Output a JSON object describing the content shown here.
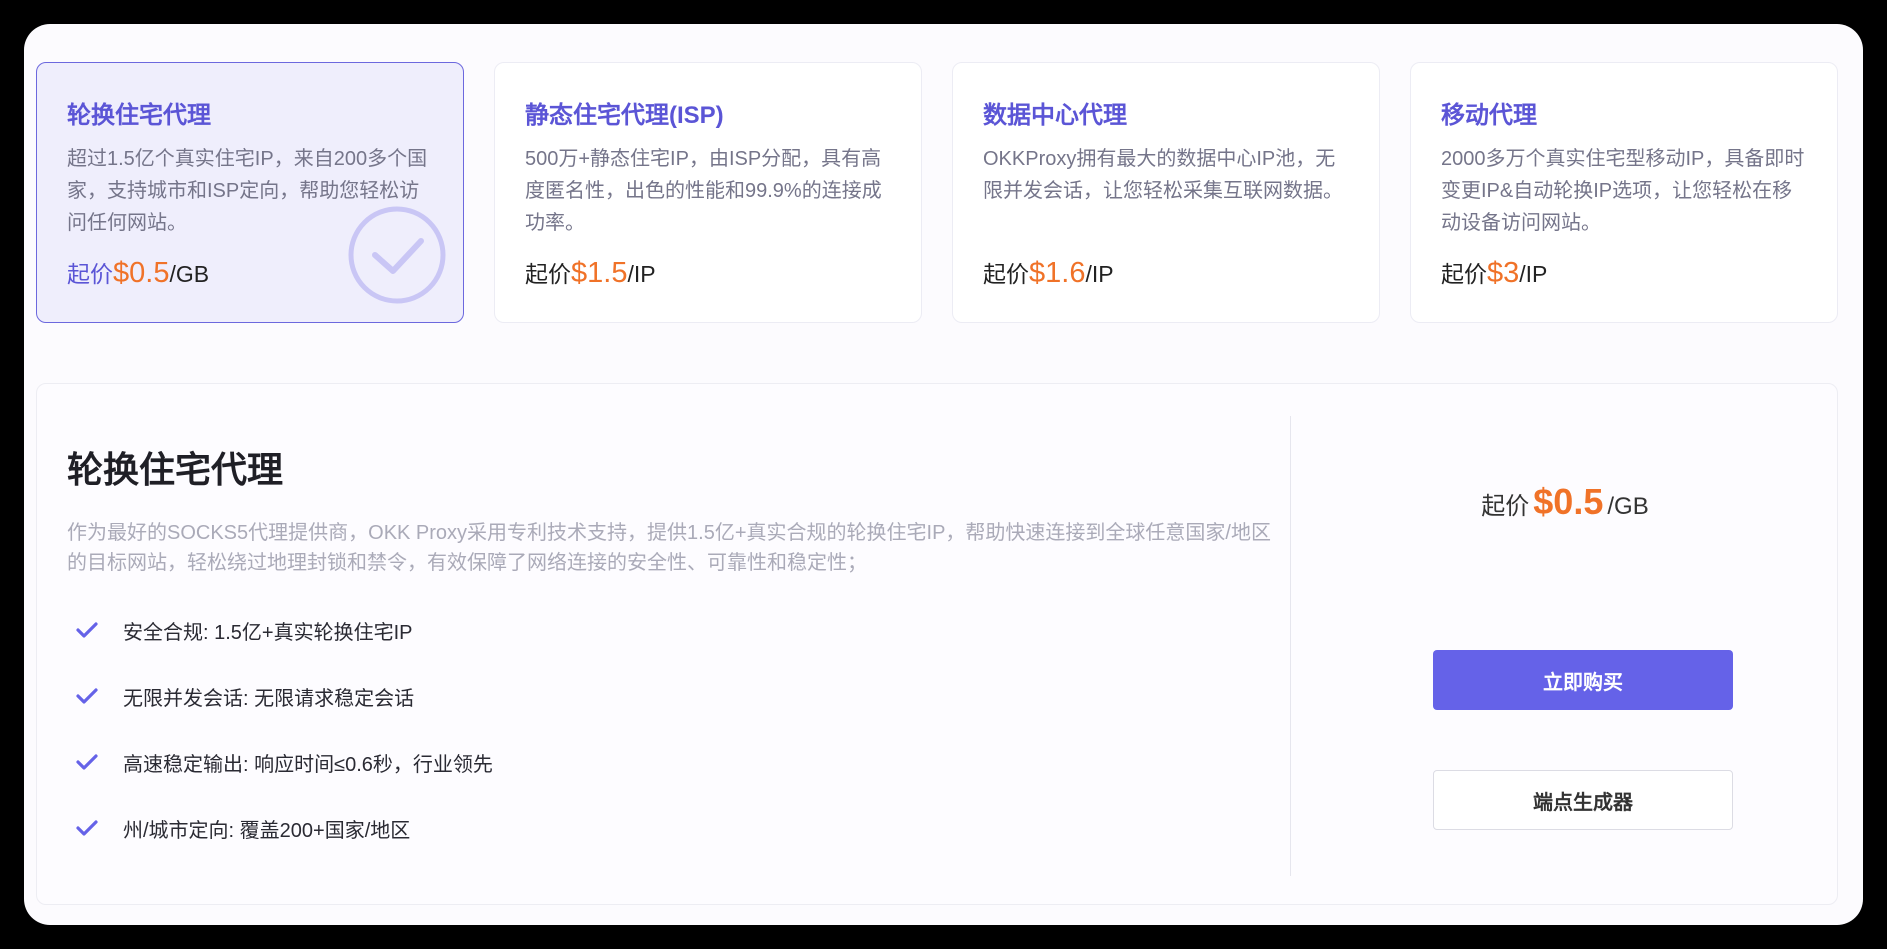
{
  "products": [
    {
      "title": "轮换住宅代理",
      "description": "超过1.5亿个真实住宅IP，来自200多个国家，支持城市和ISP定向，帮助您轻松访问任何网站。",
      "price_label": "起价",
      "price_value": "$0.5",
      "price_unit": "/GB",
      "selected": true
    },
    {
      "title": "静态住宅代理(ISP)",
      "description": "500万+静态住宅IP，由ISP分配，具有高度匿名性，出色的性能和99.9%的连接成功率。",
      "price_label": "起价",
      "price_value": "$1.5",
      "price_unit": "/IP",
      "selected": false
    },
    {
      "title": "数据中心代理",
      "description": "OKKProxy拥有最大的数据中心IP池，无限并发会话，让您轻松采集互联网数据。",
      "price_label": "起价",
      "price_value": "$1.6",
      "price_unit": "/IP",
      "selected": false
    },
    {
      "title": "移动代理",
      "description": "2000多万个真实住宅型移动IP，具备即时变更IP&自动轮换IP选项，让您轻松在移动设备访问网站。",
      "price_label": "起价",
      "price_value": "$3",
      "price_unit": "/IP",
      "selected": false
    }
  ],
  "detail": {
    "title": "轮换住宅代理",
    "description": "作为最好的SOCKS5代理提供商，OKK Proxy采用专利技术支持，提供1.5亿+真实合规的轮换住宅IP，帮助快速连接到全球任意国家/地区的目标网站，轻松绕过地理封锁和禁令，有效保障了网络连接的安全性、可靠性和稳定性；",
    "features": [
      "安全合规: 1.5亿+真实轮换住宅IP",
      "无限并发会话: 无限请求稳定会话",
      "高速稳定输出: 响应时间≤0.6秒，行业领先",
      "州/城市定向: 覆盖200+国家/地区"
    ],
    "price_label": "起价",
    "price_value": "$0.5",
    "price_unit": "/GB",
    "buy_label": "立即购买",
    "generator_label": "端点生成器"
  },
  "colors": {
    "accent": "#6562e8",
    "price": "#f07228",
    "title": "#5b55d6"
  },
  "icons": {
    "selected_badge": "check-circle-icon",
    "feature_bullet": "check-icon"
  }
}
